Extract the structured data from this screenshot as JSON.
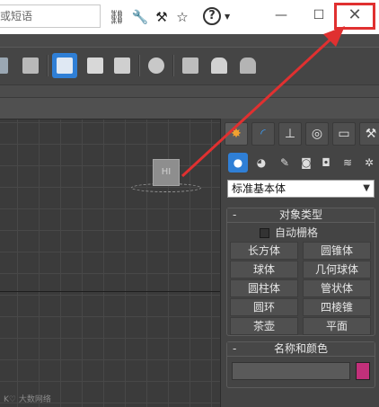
{
  "titlebar": {
    "search_text": "或短语",
    "help_label": "?",
    "minimize_glyph": "—",
    "maximize_glyph": "☐",
    "close_glyph": "✕",
    "icons": [
      "binoculars-icon",
      "wrench-icon",
      "tool-icon",
      "star-icon"
    ]
  },
  "viewport": {
    "cube_label": "HI",
    "watermark": "K♡ 大数网络"
  },
  "command_panel": {
    "tabs": [
      "create-tab",
      "modify-tab",
      "hierarchy-tab",
      "motion-tab",
      "display-tab",
      "utilities-tab"
    ],
    "sub_categories": [
      "geometry",
      "shapes",
      "lights",
      "cameras",
      "helpers",
      "spacewarps",
      "systems"
    ],
    "dropdown_value": "标准基本体",
    "object_type": {
      "header": "对象类型",
      "autogrid_label": "自动栅格",
      "buttons": [
        "长方体",
        "圆锥体",
        "球体",
        "几何球体",
        "圆柱体",
        "管状体",
        "圆环",
        "四棱锥",
        "茶壶",
        "平面"
      ]
    },
    "name_color": {
      "header": "名称和颜色",
      "name_value": "",
      "color": "#c2307a"
    }
  },
  "accent_colors": {
    "close_highlight": "#e03030",
    "active_tab": "#2f7fd6"
  }
}
